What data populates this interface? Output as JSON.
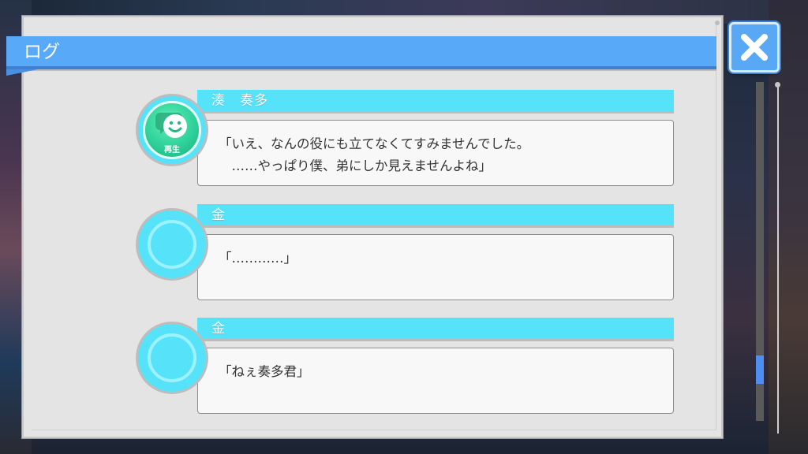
{
  "log": {
    "title": "ログ",
    "close_label": "×",
    "entries": [
      {
        "speaker": "湊　奏多",
        "text": "「いえ、なんの役にも立てなくてすみませんでした。\n　……やっぱり僕、弟にしか見えませんよね」",
        "has_voice": true,
        "voice_label": "再生"
      },
      {
        "speaker": "金",
        "text": "「…………」",
        "has_voice": false
      },
      {
        "speaker": "金",
        "text": "「ねぇ奏多君」",
        "has_voice": false
      }
    ]
  },
  "colors": {
    "title_bar": "#58a9f7",
    "name_bar": "#56e3fa",
    "play_button": "#2fd19a",
    "scroll_thumb": "#4c8ff0"
  },
  "icons": {
    "close": "close-icon",
    "play": "speech-bubble-smile-icon"
  }
}
